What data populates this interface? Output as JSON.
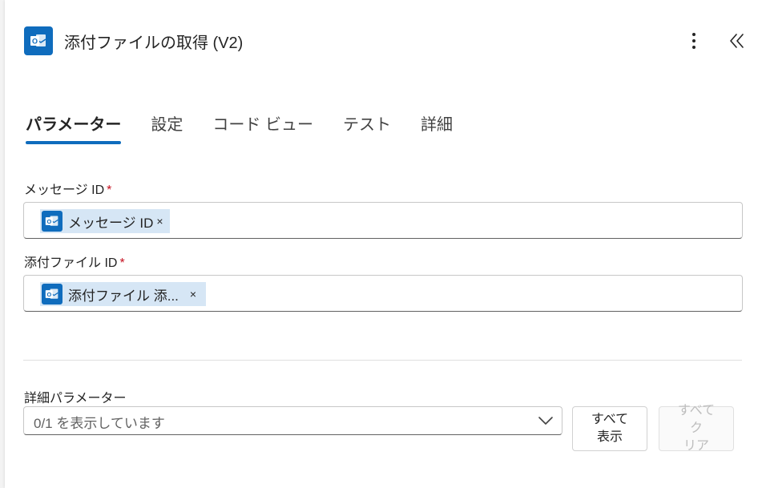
{
  "header": {
    "title": "添付ファイルの取得 (V2)",
    "icon": "outlook-icon",
    "more_icon": "more-vertical-icon",
    "collapse_icon": "double-chevron-left-icon"
  },
  "tabs": [
    {
      "label": "パラメーター",
      "active": true
    },
    {
      "label": "設定",
      "active": false
    },
    {
      "label": "コード ビュー",
      "active": false
    },
    {
      "label": "テスト",
      "active": false
    },
    {
      "label": "詳細",
      "active": false
    }
  ],
  "fields": {
    "message_id": {
      "label": "メッセージ ID",
      "required_mark": "*",
      "token_text": "メッセージ ID",
      "token_close": "×"
    },
    "attachment_id": {
      "label": "添付ファイル ID",
      "required_mark": "*",
      "token_text": "添付ファイル 添...",
      "token_close": "×"
    }
  },
  "advanced": {
    "label": "詳細パラメーター",
    "dropdown_text": "0/1 を表示しています",
    "show_all_line1": "すべて",
    "show_all_line2": "表示",
    "clear_all_line1": "すべてク",
    "clear_all_line2": "リア"
  },
  "colors": {
    "accent": "#0f6cbd",
    "token_bg": "#d6e6f5",
    "required": "#c50f1f"
  }
}
